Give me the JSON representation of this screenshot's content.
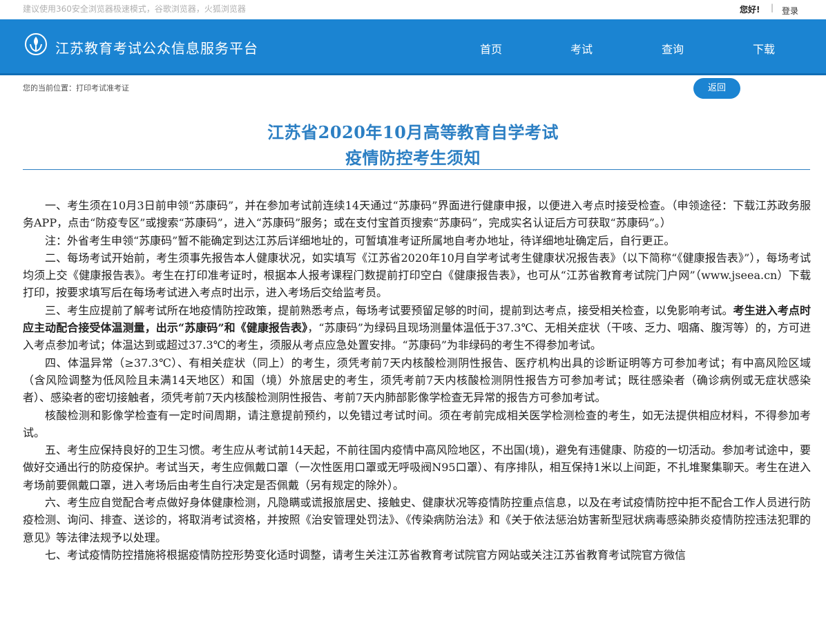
{
  "topbar": {
    "hint": "建议使用360安全浏览器极速模式，谷歌浏览器，火狐浏览器",
    "greeting": "您好!",
    "separator": "|",
    "login": "登录"
  },
  "header": {
    "logo_icon": "jiangsu-education-exam-logo",
    "site_title": "江苏教育考试公众信息服务平台",
    "nav": [
      "首页",
      "考试",
      "查询",
      "下载"
    ]
  },
  "breadcrumb": "您的当前位置：打印考试准考证",
  "back_button": "返回",
  "document": {
    "title_line1": "江苏省2020年10月高等教育自学考试",
    "title_line2": "疫情防控考生须知",
    "p1": "一、考生须在10月3日前申领“苏康码”，并在参加考试前连续14天通过“苏康码”界面进行健康申报，以便进入考点时接受检查。（申领途径：下载江苏政务服务APP，点击“防疫专区”或搜索“苏康码”，进入“苏康码”服务；或在支付宝首页搜索“苏康码”，完成实名认证后方可获取“苏康码”。）",
    "p2": "注：外省考生申领“苏康码”暂不能确定到达江苏后详细地址的，可暂填准考证所属地自考办地址，待详细地址确定后，自行更正。",
    "p3": "二、每场考试开始前，考生须事先报告本人健康状况，如实填写《江苏省2020年10月自学考试考生健康状况报告表》（以下简称“《健康报告表》”），每场考试均须上交《健康报告表》。考生在打印准考证时，根据本人报考课程门数提前打印空白《健康报告表》，也可从“江苏省教育考试院门户网”（www.jseea.cn）下载打印，按要求填写后在每场考试进入考点时出示，进入考场后交给监考员。",
    "p4_a": "三、考生应提前了解考试所在地疫情防控政策，提前熟悉考点，每场考试要预留足够的时间，提前到达考点，接受相关检查，以免影响考试。",
    "p4_b": "考生进入考点时应主动配合接受体温测量，出示“苏康码”和《健康报告表》",
    "p4_c": "，“苏康码”为绿码且现场测量体温低于37.3℃、无相关症状（干咳、乏力、咽痛、腹泻等）的，方可进入考点参加考试；体温达到或超过37.3℃的考生，须服从考点应急处置安排。“苏康码”为非绿码的考生不得参加考试。",
    "p5": "四、体温异常（≥37.3℃）、有相关症状（同上）的考生，须凭考前7天内核酸检测阴性报告、医疗机构出具的诊断证明等方可参加考试；有中高风险区域（含风险调整为低风险且未满14天地区）和国（境）外旅居史的考生，须凭考前7天内核酸检测阴性报告方可参加考试；既往感染者（确诊病例或无症状感染者）、感染者的密切接触者，须凭考前7天内核酸检测阴性报告、考前7天内肺部影像学检查无异常的报告方可参加考试。",
    "p6": "核酸检测和影像学检查有一定时间周期，请注意提前预约，以免错过考试时间。须在考前完成相关医学检测检查的考生，如无法提供相应材料，不得参加考试。",
    "p7": "五、考生应保持良好的卫生习惯。考生应从考试前14天起，不前往国内疫情中高风险地区，不出国(境)，避免有违健康、防疫的一切活动。参加考试途中，要做好交通出行的防疫保护。考试当天，考生应佩戴口罩（一次性医用口罩或无呼吸阀N95口罩）、有序排队，相互保持1米以上间距，不扎堆聚集聊天。考生在进入考场前要佩戴口罩，进入考场后由考生自行决定是否佩戴（另有规定的除外）。",
    "p8": "六、考生应自觉配合考点做好身体健康检测，凡隐瞒或谎报旅居史、接触史、健康状况等疫情防控重点信息，以及在考试疫情防控中拒不配合工作人员进行防疫检测、询问、排查、送诊的，将取消考试资格，并按照《治安管理处罚法》、《传染病防治法》和《关于依法惩治妨害新型冠状病毒感染肺炎疫情防控违法犯罪的意见》等法律法规予以处理。",
    "p9": "七、考试疫情防控措施将根据疫情防控形势变化适时调整，请考生关注江苏省教育考试院官方网站或关注江苏省教育考试院官方微信"
  },
  "colors": {
    "nav_bg": "#1b84d2",
    "title": "#2c7fc3"
  }
}
